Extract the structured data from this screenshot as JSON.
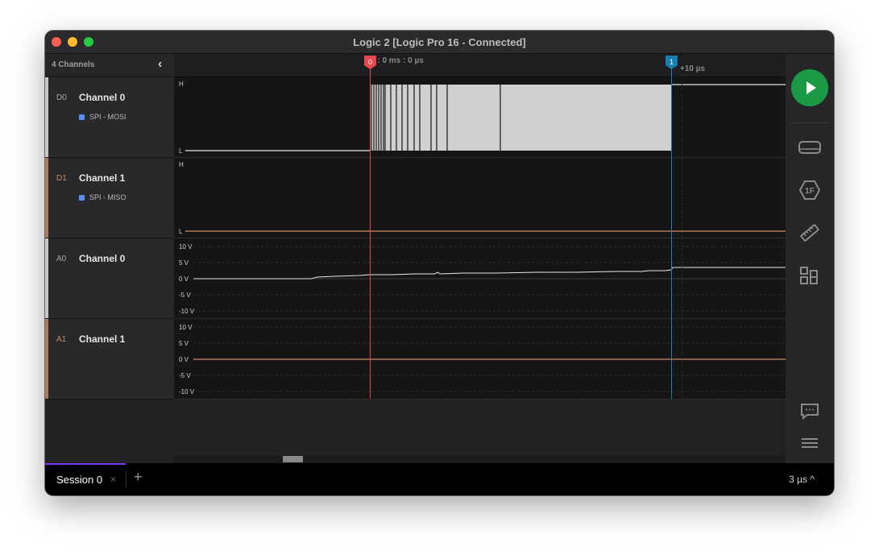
{
  "window": {
    "title": "Logic 2 [Logic Pro 16 - Connected]"
  },
  "sidebar": {
    "header": "4 Channels",
    "channels": [
      {
        "id": "D0",
        "name": "Channel 0",
        "analyzer": "SPI - MOSI",
        "color": "#c8c8c8"
      },
      {
        "id": "D1",
        "name": "Channel 1",
        "analyzer": "SPI - MISO",
        "color": "#b07a5c"
      },
      {
        "id": "A0",
        "name": "Channel 0",
        "color": "#c8c8c8"
      },
      {
        "id": "A1",
        "name": "Channel 1",
        "color": "#b07a5c"
      }
    ]
  },
  "timeline": {
    "time_label": "s : 0 ms : 0 µs",
    "marker0": "0",
    "marker1": "1",
    "offset_label": "+10 µs"
  },
  "digital_labels": {
    "high": "H",
    "low": "L"
  },
  "analog_scale": [
    "10 V",
    "5 V",
    "0 V",
    "-5 V",
    "-10 V"
  ],
  "colors": {
    "marker0": "#e8484d",
    "marker1": "#1a7fb0",
    "trace_white": "#e8e8e8",
    "trace_orange": "#d08a62",
    "play": "#1a9a45",
    "tab_indicator": "#7c3aed"
  },
  "right_toolbar": {
    "icons": [
      "play-icon",
      "device-icon",
      "trigger-icon",
      "measure-icon",
      "extensions-icon",
      "comment-icon",
      "menu-icon"
    ]
  },
  "tabs": {
    "session": "Session 0",
    "close": "×",
    "add": "+",
    "zoom": "3 µs ^"
  }
}
